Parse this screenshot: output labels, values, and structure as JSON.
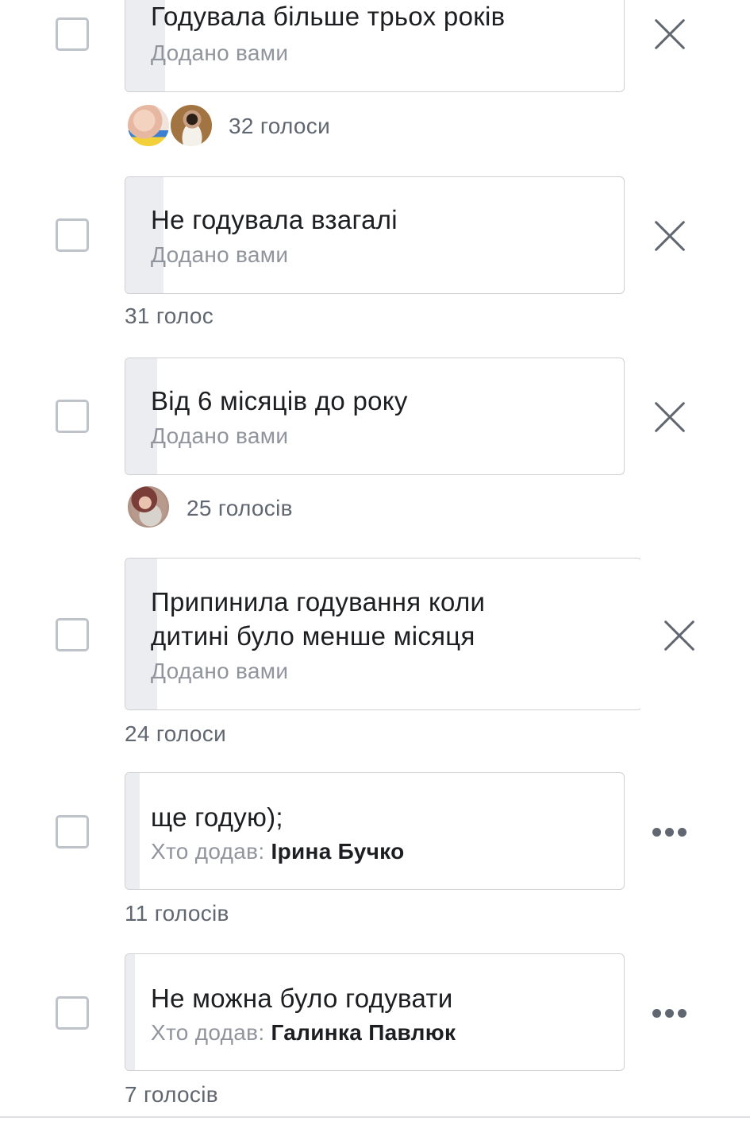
{
  "options": [
    {
      "text": "Годувала більше трьох років",
      "added_by_label": "Додано вами",
      "added_by_name": "",
      "votes": "32 голоси",
      "action": "remove-icon",
      "has_avatars": true,
      "vote_share": 0.08
    },
    {
      "text": "Не годувала взагалі",
      "added_by_label": "Додано вами",
      "added_by_name": "",
      "votes": "31 голос",
      "action": "remove-icon",
      "has_avatars": false,
      "vote_share": 0.08
    },
    {
      "text": "Від 6 місяців до року",
      "added_by_label": "Додано вами",
      "added_by_name": "",
      "votes": "25 голосів",
      "action": "remove-icon",
      "has_avatars": true,
      "vote_share": 0.06
    },
    {
      "text": "Припинила годування коли дитині було менше місяця",
      "added_by_label": "Додано вами",
      "added_by_name": "",
      "votes": "24 голоси",
      "action": "remove-icon",
      "has_avatars": false,
      "vote_share": 0.06
    },
    {
      "text": "ще годую);",
      "added_by_label": "Хто додав: ",
      "added_by_name": "Ірина Бучко",
      "votes": "11 голосів",
      "action": "more-icon",
      "has_avatars": false,
      "vote_share": 0.03
    },
    {
      "text": "Не можна було годувати",
      "added_by_label": "Хто додав: ",
      "added_by_name": "Галинка Павлюк",
      "votes": "7 голосів",
      "action": "more-icon",
      "has_avatars": false,
      "vote_share": 0.02
    }
  ],
  "colors": {
    "fill": "#ebedf0",
    "border": "#ced0d4",
    "secondary_text": "#90949c",
    "icon": "#606770"
  }
}
